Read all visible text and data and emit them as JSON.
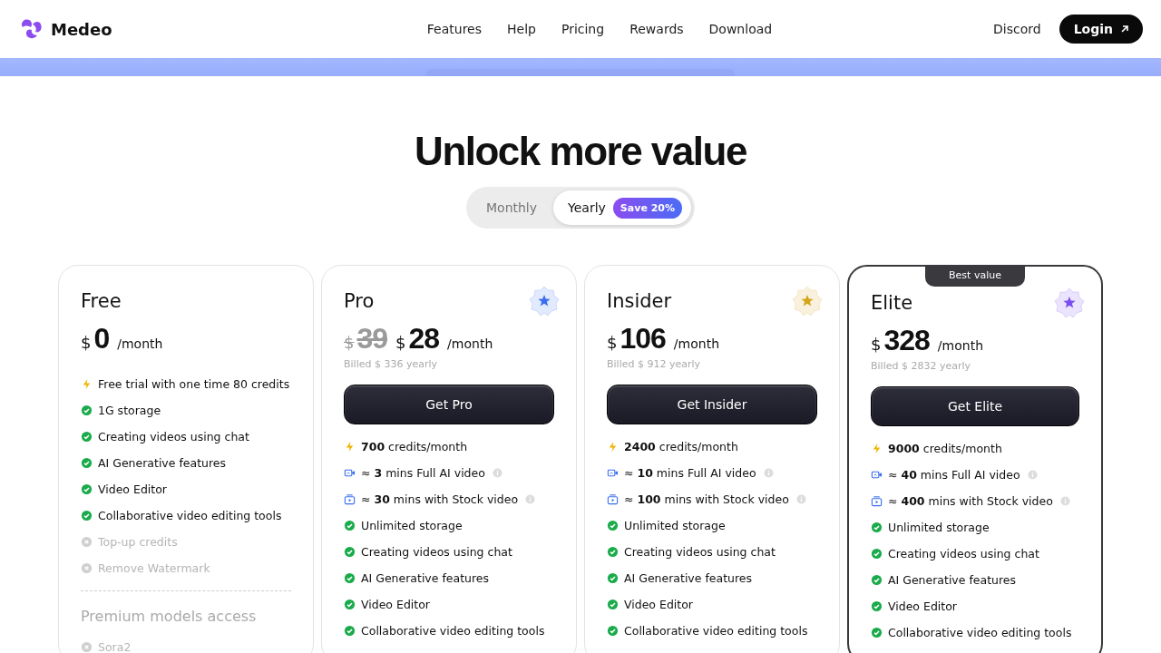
{
  "brand": {
    "name": "Medeo"
  },
  "nav": [
    "Features",
    "Help",
    "Pricing",
    "Rewards",
    "Download"
  ],
  "header_links": {
    "discord": "Discord",
    "login": "Login"
  },
  "title": "Unlock more value",
  "billing_toggle": [
    {
      "label": "Monthly",
      "selected": false
    },
    {
      "label": "Yearly",
      "selected": true,
      "badge": "Save 20%"
    }
  ],
  "plans": [
    {
      "name": "Free",
      "featured": false,
      "currency": "$",
      "price": "0",
      "period": "/month",
      "features": [
        {
          "kind": "credits",
          "text": "Free trial with one time 80 credits"
        },
        {
          "kind": "included",
          "text": "1G storage"
        },
        {
          "kind": "included",
          "text": "Creating videos using chat"
        },
        {
          "kind": "included",
          "text": "AI Generative features"
        },
        {
          "kind": "included",
          "text": "Video Editor"
        },
        {
          "kind": "included",
          "text": "Collaborative video editing tools"
        },
        {
          "kind": "excluded",
          "text": "Top-up credits"
        },
        {
          "kind": "excluded",
          "text": "Remove Watermark"
        }
      ],
      "section": "Premium models access",
      "section_items": [
        {
          "kind": "excluded",
          "text": "Sora2"
        }
      ]
    },
    {
      "name": "Pro",
      "featured": false,
      "color": "#3b6ff0",
      "old_currency": "$",
      "old_price": "39",
      "currency": "$",
      "price": "28",
      "period": "/month",
      "billed": "Billed $ 336 yearly",
      "button": "Get Pro",
      "features": [
        {
          "kind": "credits",
          "text": "**700** credits/month"
        },
        {
          "kind": "ai_video",
          "text": "≈ **3** mins Full AI video",
          "info": true
        },
        {
          "kind": "stock_video",
          "text": "≈ **30** mins with Stock video",
          "info": true
        },
        {
          "kind": "included",
          "text": "Unlimited storage"
        },
        {
          "kind": "included",
          "text": "Creating videos using chat"
        },
        {
          "kind": "included",
          "text": "AI Generative features"
        },
        {
          "kind": "included",
          "text": "Video Editor"
        },
        {
          "kind": "included",
          "text": "Collaborative video editing tools"
        }
      ]
    },
    {
      "name": "Insider",
      "featured": false,
      "color": "#d4a418",
      "currency": "$",
      "price": "106",
      "period": "/month",
      "billed": "Billed $ 912 yearly",
      "button": "Get Insider",
      "features": [
        {
          "kind": "credits",
          "text": "**2400** credits/month"
        },
        {
          "kind": "ai_video",
          "text": "≈ **10** mins Full AI video",
          "info": true
        },
        {
          "kind": "stock_video",
          "text": "≈ **100** mins with Stock video",
          "info": true
        },
        {
          "kind": "included",
          "text": "Unlimited storage"
        },
        {
          "kind": "included",
          "text": "Creating videos using chat"
        },
        {
          "kind": "included",
          "text": "AI Generative features"
        },
        {
          "kind": "included",
          "text": "Video Editor"
        },
        {
          "kind": "included",
          "text": "Collaborative video editing tools"
        }
      ]
    },
    {
      "name": "Elite",
      "featured": true,
      "badge": "Best value",
      "color": "#7c4df0",
      "currency": "$",
      "price": "328",
      "period": "/month",
      "billed": "Billed $ 2832 yearly",
      "button": "Get Elite",
      "features": [
        {
          "kind": "credits",
          "text": "**9000** credits/month"
        },
        {
          "kind": "ai_video",
          "text": "≈ **40** mins Full AI video",
          "info": true
        },
        {
          "kind": "stock_video",
          "text": "≈ **400** mins with Stock video",
          "info": true
        },
        {
          "kind": "included",
          "text": "Unlimited storage"
        },
        {
          "kind": "included",
          "text": "Creating videos using chat"
        },
        {
          "kind": "included",
          "text": "AI Generative features"
        },
        {
          "kind": "included",
          "text": "Video Editor"
        },
        {
          "kind": "included",
          "text": "Collaborative video editing tools"
        }
      ]
    }
  ]
}
